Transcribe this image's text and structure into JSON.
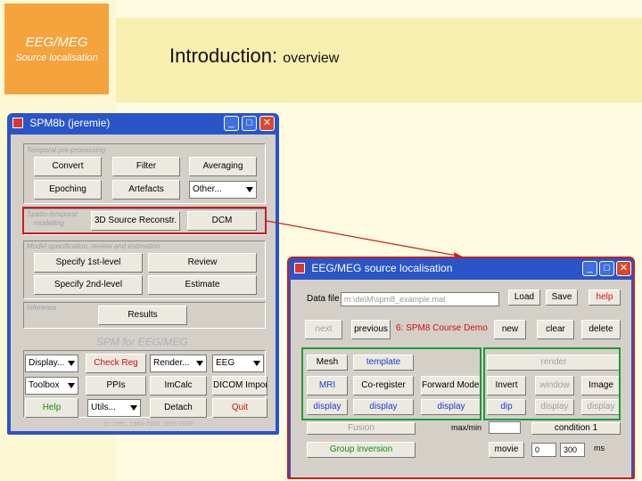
{
  "brand": {
    "title": "EEG/MEG",
    "subtitle": "Source localisation"
  },
  "slide": {
    "title": "Introduction:",
    "subtitle": "overview"
  },
  "spm_window": {
    "title": "SPM8b (jeremie)",
    "panels": {
      "temporal": "Temporal pre-processing",
      "spatio_line1": "Spatio-temporal",
      "spatio_line2": "modelling",
      "model": "Model specification, review and estimation",
      "inference": "Inference"
    },
    "buttons": {
      "convert": "Convert",
      "filter": "Filter",
      "averaging": "Averaging",
      "epoching": "Epoching",
      "artefacts": "Artefacts",
      "source_reconstr": "3D Source Reconstr.",
      "dcm": "DCM",
      "specify_first": "Specify 1st-level",
      "review": "Review",
      "specify_second": "Specify 2nd-level",
      "estimate": "Estimate",
      "results": "Results",
      "check_reg": "Check Reg",
      "ppis": "PPIs",
      "imcalc": "ImCalc",
      "dicom_import": "DICOM Import",
      "help": "Help",
      "detach": "Detach",
      "quit": "Quit"
    },
    "dropdowns": {
      "other": "Other...",
      "display": "Display...",
      "render": "Render...",
      "modality": "EEG",
      "toolbox": "Toolbox",
      "utils": "Utils..."
    },
    "footer_title": "SPM for EEG/MEG",
    "copyright": "(c) 1991, 1994-2003, 2005-2008"
  },
  "eeg_window": {
    "title": "EEG/MEG source localisation",
    "data_file_label": "Data file",
    "data_file_value": "m:\\de\\M\\spm8_example.mat",
    "buttons": {
      "load": "Load",
      "save": "Save",
      "help": "help",
      "new": "new",
      "previous": "previous",
      "next": "next",
      "clear": "clear",
      "delete": "delete",
      "mesh": "Mesh",
      "template": "template",
      "render": "render",
      "mri": "MRI",
      "coregister": "Co-register",
      "forward_model": "Forward Model",
      "invert": "Invert",
      "window": "window",
      "image": "Image",
      "display1": "display",
      "display2": "display",
      "display3": "display",
      "vb_ecd": "dip",
      "display4": "display",
      "display5": "display",
      "fusion": "Fusion",
      "condition": "condition 1",
      "group_inversion": "Group inversion",
      "movie": "movie"
    },
    "session_label": "6: SPM8 Course Demo",
    "ms_label": "ms",
    "max_label": "max/min",
    "movie_from": "0",
    "movie_to": "300"
  },
  "colors": {
    "highlight_red": "#c81e1e",
    "highlight_green": "#1c9a3a",
    "window_blue": "#2a55c8"
  }
}
